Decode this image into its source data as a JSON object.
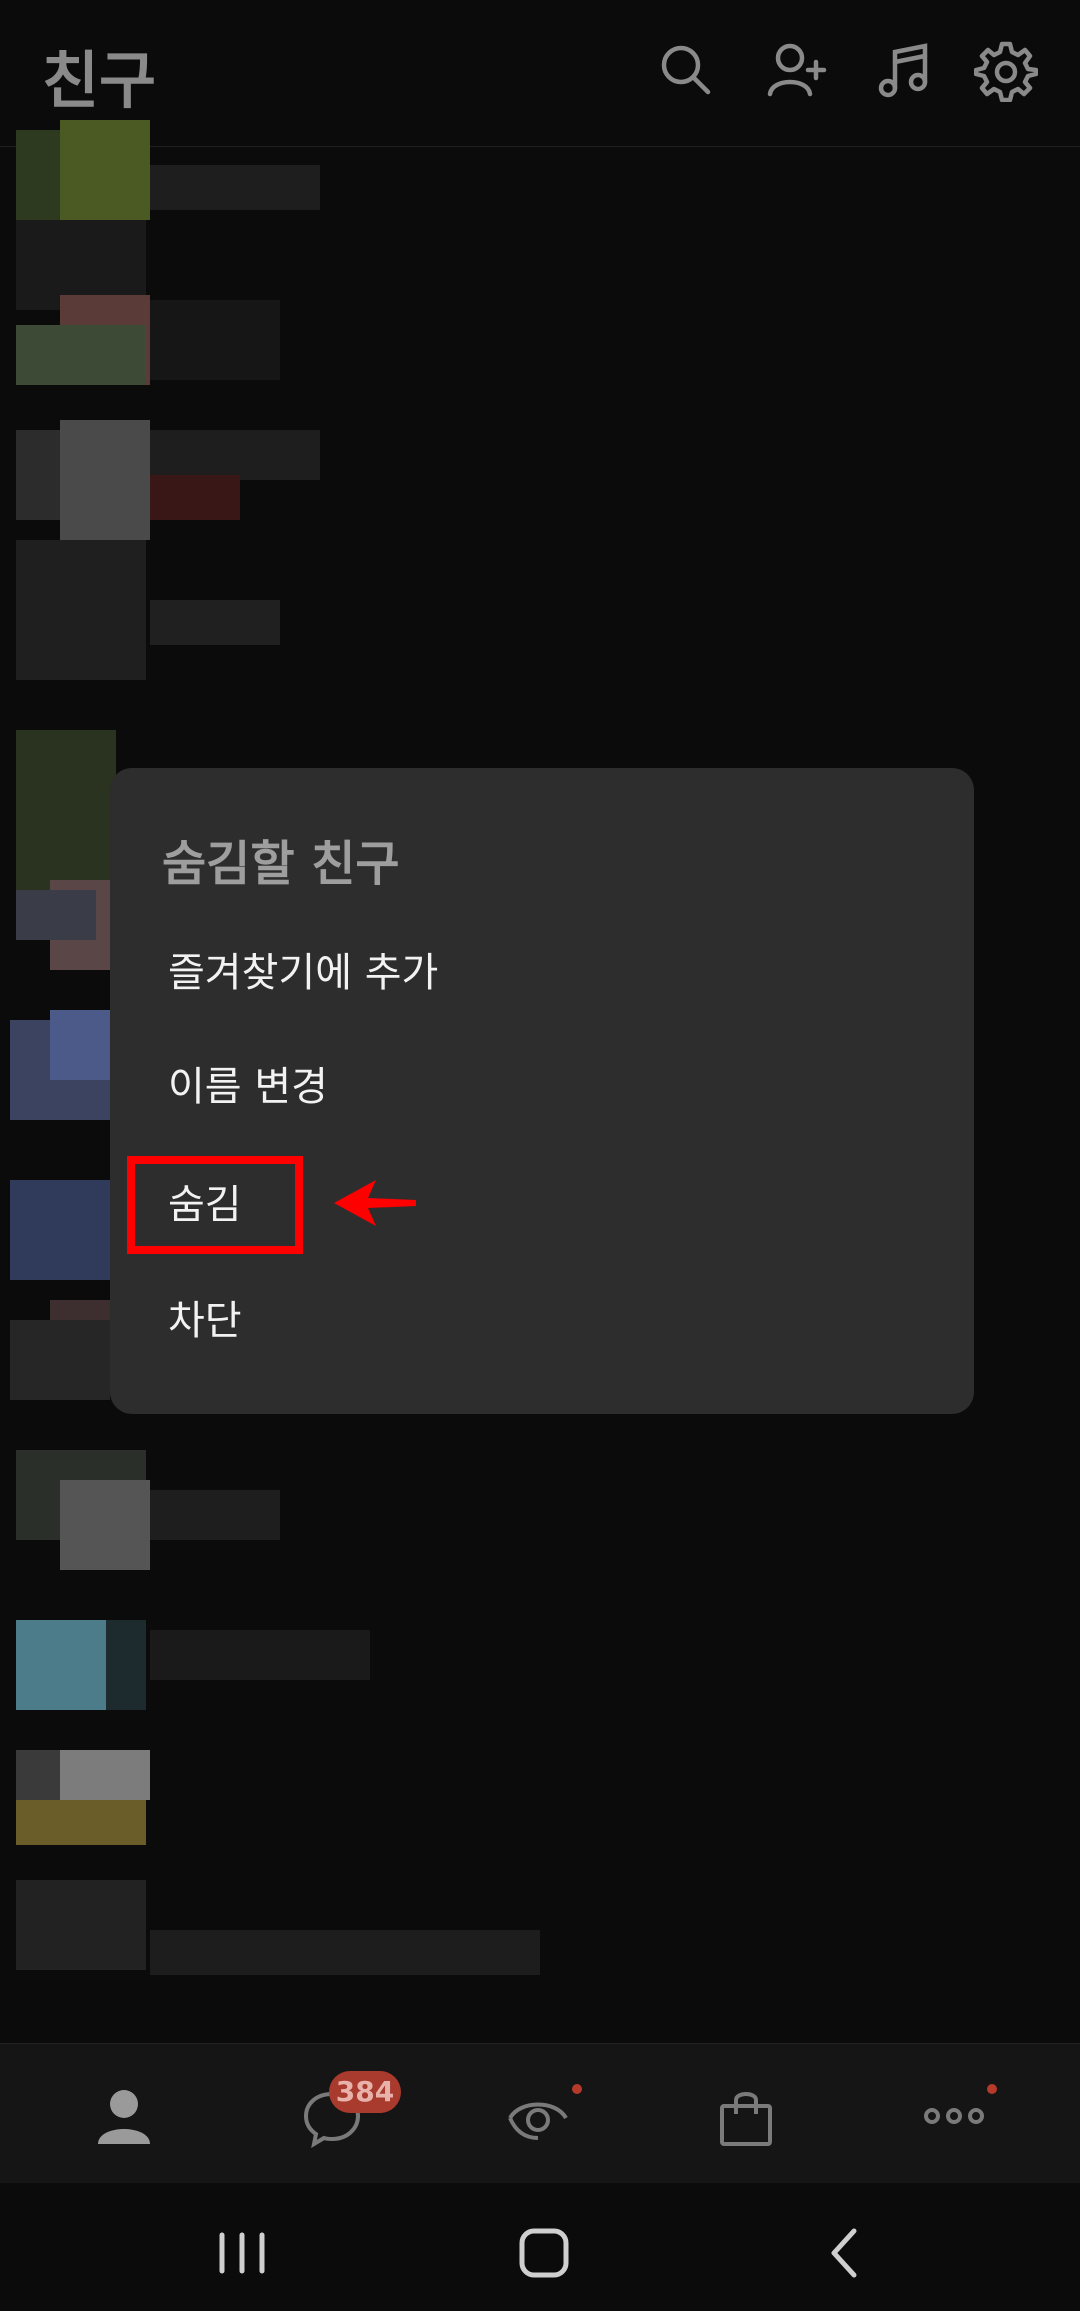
{
  "header": {
    "title": "친구",
    "icons": [
      "search-icon",
      "add-friend-icon",
      "music-icon",
      "settings-icon"
    ]
  },
  "context_menu": {
    "title": "숨김할 친구",
    "items": [
      {
        "label": "즐겨찾기에 추가"
      },
      {
        "label": "이름 변경"
      },
      {
        "label": "숨김"
      },
      {
        "label": "차단"
      }
    ],
    "highlighted_item": "숨김"
  },
  "bottom_tabs": {
    "items": [
      "friends-tab",
      "chats-tab",
      "view-tab",
      "shopping-tab",
      "more-tab"
    ],
    "chat_badge": "384"
  },
  "system_nav": [
    "recent-apps-button",
    "home-button",
    "back-button"
  ],
  "colors": {
    "background": "#0b0b0b",
    "menu_background": "#2d2d2d",
    "highlight": "#ff0000",
    "badge": "#a83a2e"
  }
}
